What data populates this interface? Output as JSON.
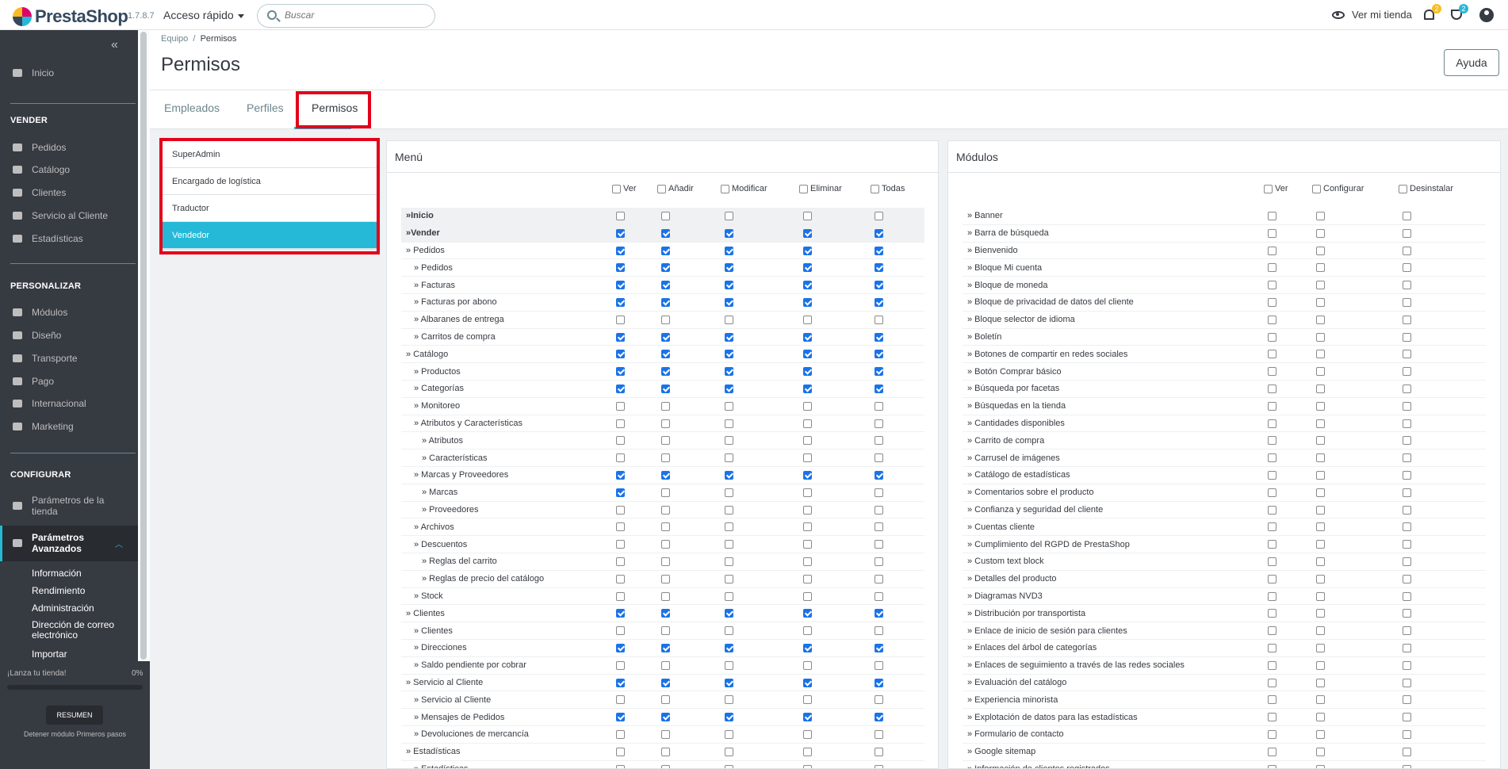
{
  "app": {
    "logo": "PrestaShop",
    "version": "1.7.8.7",
    "quick_access": "Acceso rápido",
    "search_placeholder": "Buscar",
    "view_shop": "Ver mi tienda",
    "notif_count": "2",
    "trophy_count": "2"
  },
  "sidebar": {
    "inicio": "Inicio",
    "sections": {
      "vender": "VENDER",
      "personalizar": "PERSONALIZAR",
      "configurar": "CONFIGURAR"
    },
    "vender_items": [
      "Pedidos",
      "Catálogo",
      "Clientes",
      "Servicio al Cliente",
      "Estadísticas"
    ],
    "personalizar_items": [
      "Módulos",
      "Diseño",
      "Transporte",
      "Pago",
      "Internacional",
      "Marketing"
    ],
    "config_items": [
      "Parámetros de la tienda",
      "Parámetros Avanzados"
    ],
    "sub_items": [
      "Información",
      "Rendimiento",
      "Administración",
      "Dirección de correo electrónico",
      "Importar"
    ],
    "launch_label": "¡Lanza tu tienda!",
    "launch_pct": "0%",
    "launch_progress": 0,
    "resumen": "RESUMEN",
    "stop": "Detener módulo Primeros pasos"
  },
  "header": {
    "breadcrumb_parent": "Equipo",
    "breadcrumb_sep": "/",
    "breadcrumb_current": "Permisos",
    "title": "Permisos",
    "help": "Ayuda"
  },
  "tabs": [
    "Empleados",
    "Perfiles",
    "Permisos"
  ],
  "profiles": [
    "SuperAdmin",
    "Encargado de logística",
    "Traductor",
    "Vendedor"
  ],
  "menu_panel": {
    "title": "Menú",
    "columns": [
      "Ver",
      "Añadir",
      "Modificar",
      "Eliminar",
      "Todas"
    ],
    "rows": [
      {
        "label": "»Inicio",
        "level": 0,
        "head": true,
        "checks": [
          0,
          0,
          0,
          0,
          0
        ]
      },
      {
        "label": "»Vender",
        "level": 0,
        "head": true,
        "checks": [
          1,
          1,
          1,
          1,
          1
        ]
      },
      {
        "label": "» Pedidos",
        "level": 0,
        "checks": [
          1,
          1,
          1,
          1,
          1
        ]
      },
      {
        "label": "» Pedidos",
        "level": 1,
        "checks": [
          1,
          1,
          1,
          1,
          1
        ]
      },
      {
        "label": "» Facturas",
        "level": 1,
        "checks": [
          1,
          1,
          1,
          1,
          1
        ]
      },
      {
        "label": "» Facturas por abono",
        "level": 1,
        "checks": [
          1,
          1,
          1,
          1,
          1
        ]
      },
      {
        "label": "» Albaranes de entrega",
        "level": 1,
        "checks": [
          0,
          0,
          0,
          0,
          0
        ]
      },
      {
        "label": "» Carritos de compra",
        "level": 1,
        "checks": [
          1,
          1,
          1,
          1,
          1
        ]
      },
      {
        "label": "» Catálogo",
        "level": 0,
        "checks": [
          1,
          1,
          1,
          1,
          1
        ]
      },
      {
        "label": "» Productos",
        "level": 1,
        "checks": [
          1,
          1,
          1,
          1,
          1
        ]
      },
      {
        "label": "» Categorías",
        "level": 1,
        "checks": [
          1,
          1,
          1,
          1,
          1
        ]
      },
      {
        "label": "» Monitoreo",
        "level": 1,
        "checks": [
          0,
          0,
          0,
          0,
          0
        ]
      },
      {
        "label": "» Atributos y Características",
        "level": 1,
        "checks": [
          0,
          0,
          0,
          0,
          0
        ]
      },
      {
        "label": "» Atributos",
        "level": 2,
        "checks": [
          0,
          0,
          0,
          0,
          0
        ]
      },
      {
        "label": "» Características",
        "level": 2,
        "checks": [
          0,
          0,
          0,
          0,
          0
        ]
      },
      {
        "label": "» Marcas y Proveedores",
        "level": 1,
        "checks": [
          1,
          1,
          1,
          1,
          1
        ]
      },
      {
        "label": "» Marcas",
        "level": 2,
        "checks": [
          1,
          0,
          0,
          0,
          0
        ]
      },
      {
        "label": "» Proveedores",
        "level": 2,
        "checks": [
          0,
          0,
          0,
          0,
          0
        ]
      },
      {
        "label": "» Archivos",
        "level": 1,
        "checks": [
          0,
          0,
          0,
          0,
          0
        ]
      },
      {
        "label": "» Descuentos",
        "level": 1,
        "checks": [
          0,
          0,
          0,
          0,
          0
        ]
      },
      {
        "label": "» Reglas del carrito",
        "level": 2,
        "checks": [
          0,
          0,
          0,
          0,
          0
        ]
      },
      {
        "label": "» Reglas de precio del catálogo",
        "level": 2,
        "checks": [
          0,
          0,
          0,
          0,
          0
        ]
      },
      {
        "label": "» Stock",
        "level": 1,
        "checks": [
          0,
          0,
          0,
          0,
          0
        ]
      },
      {
        "label": "» Clientes",
        "level": 0,
        "checks": [
          1,
          1,
          1,
          1,
          1
        ]
      },
      {
        "label": "» Clientes",
        "level": 1,
        "checks": [
          0,
          0,
          0,
          0,
          0
        ]
      },
      {
        "label": "» Direcciones",
        "level": 1,
        "checks": [
          1,
          1,
          1,
          1,
          1
        ]
      },
      {
        "label": "» Saldo pendiente por cobrar",
        "level": 1,
        "checks": [
          0,
          0,
          0,
          0,
          0
        ]
      },
      {
        "label": "» Servicio al Cliente",
        "level": 0,
        "checks": [
          1,
          1,
          1,
          1,
          1
        ]
      },
      {
        "label": "» Servicio al Cliente",
        "level": 1,
        "checks": [
          0,
          0,
          0,
          0,
          0
        ]
      },
      {
        "label": "» Mensajes de Pedidos",
        "level": 1,
        "checks": [
          1,
          1,
          1,
          1,
          1
        ]
      },
      {
        "label": "» Devoluciones de mercancía",
        "level": 1,
        "checks": [
          0,
          0,
          0,
          0,
          0
        ]
      },
      {
        "label": "» Estadísticas",
        "level": 0,
        "checks": [
          0,
          0,
          0,
          0,
          0
        ]
      },
      {
        "label": "» Estadísticas",
        "level": 1,
        "checks": [
          0,
          0,
          0,
          0,
          0
        ]
      }
    ]
  },
  "modules_panel": {
    "title": "Módulos",
    "columns": [
      "Ver",
      "Configurar",
      "Desinstalar"
    ],
    "rows": [
      "» Banner",
      "» Barra de búsqueda",
      "» Bienvenido",
      "» Bloque Mi cuenta",
      "» Bloque de moneda",
      "» Bloque de privacidad de datos del cliente",
      "» Bloque selector de idioma",
      "» Boletín",
      "» Botones de compartir en redes sociales",
      "» Botón Comprar básico",
      "» Búsqueda por facetas",
      "» Búsquedas en la tienda",
      "» Cantidades disponibles",
      "» Carrito de compra",
      "» Carrusel de imágenes",
      "» Catálogo de estadísticas",
      "» Comentarios sobre el producto",
      "» Confianza y seguridad del cliente",
      "» Cuentas cliente",
      "» Cumplimiento del RGPD de PrestaShop",
      "» Custom text block",
      "» Detalles del producto",
      "» Diagramas NVD3",
      "» Distribución por transportista",
      "» Enlace de inicio de sesión para clientes",
      "» Enlaces del árbol de categorías",
      "» Enlaces de seguimiento a través de las redes sociales",
      "» Evaluación del catálogo",
      "» Experiencia minorista",
      "» Explotación de datos para las estadísticas",
      "» Formulario de contacto",
      "» Google sitemap",
      "» Información de clientes registrados"
    ]
  },
  "colors": {
    "accent": "#25b9d7",
    "sidebar": "#363a41",
    "highlight": "#e3001b"
  }
}
